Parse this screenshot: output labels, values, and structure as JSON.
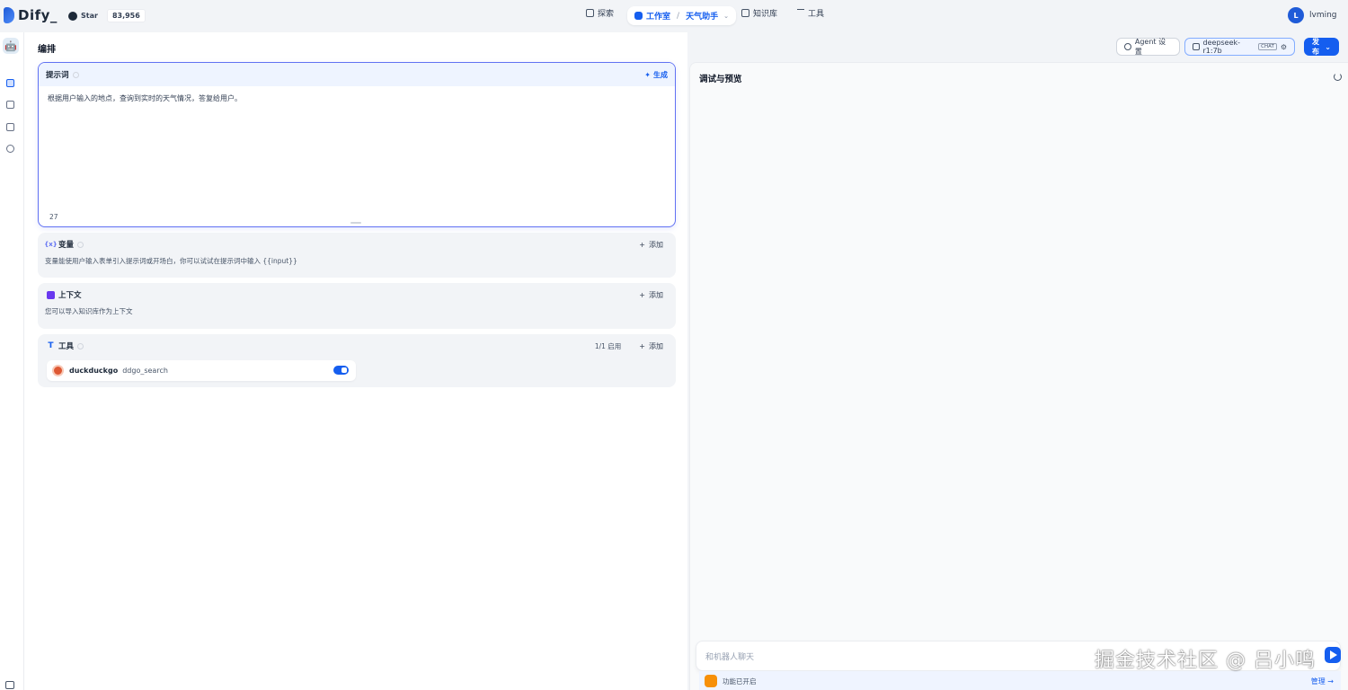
{
  "app": {
    "brand": "Dify_",
    "github_label": "Star",
    "github_count": "83,956"
  },
  "nav": {
    "explore": "探索",
    "studio": "工作室",
    "app_name": "天气助手",
    "knowledge": "知识库",
    "tools": "工具"
  },
  "user": {
    "initial": "L",
    "name": "lvming"
  },
  "header": {
    "title": "编排",
    "agent_settings": "Agent 设置",
    "model": "deepseek-r1:7b",
    "model_badge": "CHAT",
    "publish": "发布"
  },
  "prompt": {
    "title": "提示词",
    "generate": "生成",
    "text": "根据用户输入的地点，查询到实时的天气情况，答复给用户。",
    "char_count": "27"
  },
  "variables": {
    "title": "变量",
    "add": "添加",
    "description": "变量能使用户输入表单引入提示词或开场白，你可以试试在提示词中输入 {{input}}"
  },
  "context": {
    "title": "上下文",
    "add": "添加",
    "description": "您可以导入知识库作为上下文"
  },
  "tools": {
    "title": "工具",
    "enabled": "1/1 启用",
    "add": "添加",
    "items": [
      {
        "provider": "duckduckgo",
        "action": "ddgo_search",
        "enabled": true
      }
    ]
  },
  "debug": {
    "title": "调试与预览",
    "input_placeholder": "和机器人聊天",
    "features_label": "功能已开启",
    "manage": "管理 →"
  },
  "watermark": "掘金技术社区 @ 吕小鸣",
  "colors": {
    "accent": "#155eef",
    "prompt_border": "#6172f3",
    "toggle_on": "#155eef"
  }
}
